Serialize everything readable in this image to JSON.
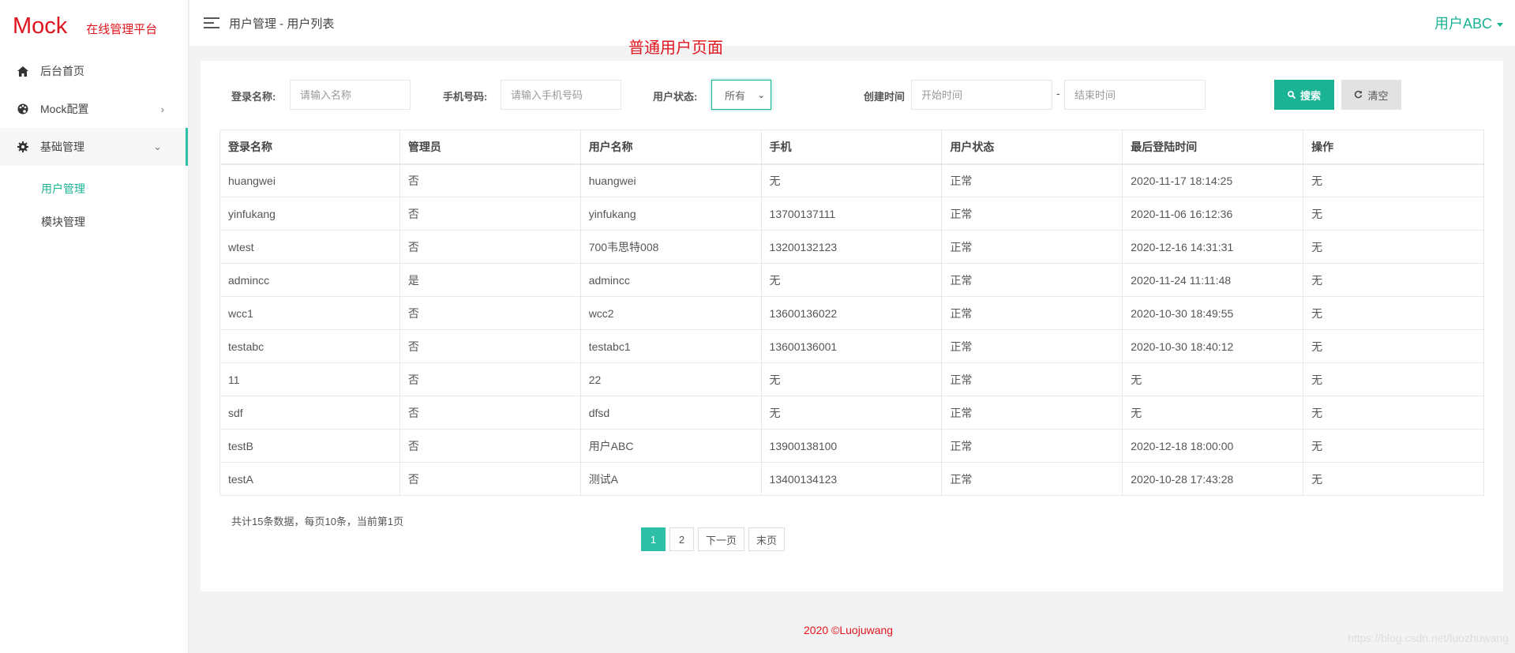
{
  "brand": {
    "name": "Mock",
    "subtitle": "在线管理平台"
  },
  "sidebar": {
    "items": [
      {
        "label": "后台首页",
        "icon": "home-icon"
      },
      {
        "label": "Mock配置",
        "icon": "palette-icon"
      },
      {
        "label": "基础管理",
        "icon": "gear-icon"
      }
    ],
    "sub_items": [
      {
        "label": "用户管理"
      },
      {
        "label": "模块管理"
      }
    ]
  },
  "header": {
    "breadcrumb": "用户管理 - 用户列表",
    "user": "用户ABC"
  },
  "annotation": "普通用户页面",
  "filters": {
    "login_label": "登录名称:",
    "login_placeholder": "请输入名称",
    "phone_label": "手机号码:",
    "phone_placeholder": "请输入手机号码",
    "status_label": "用户状态:",
    "status_value": "所有",
    "created_label": "创建时间",
    "start_placeholder": "开始时间",
    "separator": "-",
    "end_placeholder": "结束时间",
    "search_label": "搜索",
    "clear_label": "清空"
  },
  "table": {
    "columns": [
      "登录名称",
      "管理员",
      "用户名称",
      "手机",
      "用户状态",
      "最后登陆时间",
      "操作"
    ],
    "rows": [
      [
        "huangwei",
        "否",
        "huangwei",
        "无",
        "正常",
        "2020-11-17 18:14:25",
        "无"
      ],
      [
        "yinfukang",
        "否",
        "yinfukang",
        "13700137111",
        "正常",
        "2020-11-06 16:12:36",
        "无"
      ],
      [
        "wtest",
        "否",
        "700韦思特008",
        "13200132123",
        "正常",
        "2020-12-16 14:31:31",
        "无"
      ],
      [
        "admincc",
        "是",
        "admincc",
        "无",
        "正常",
        "2020-11-24 11:11:48",
        "无"
      ],
      [
        "wcc1",
        "否",
        "wcc2",
        "13600136022",
        "正常",
        "2020-10-30 18:49:55",
        "无"
      ],
      [
        "testabc",
        "否",
        "testabc1",
        "13600136001",
        "正常",
        "2020-10-30 18:40:12",
        "无"
      ],
      [
        "11",
        "否",
        "22",
        "无",
        "正常",
        "无",
        "无"
      ],
      [
        "sdf",
        "否",
        "dfsd",
        "无",
        "正常",
        "无",
        "无"
      ],
      [
        "testB",
        "否",
        "用户ABC",
        "13900138100",
        "正常",
        "2020-12-18 18:00:00",
        "无"
      ],
      [
        "testA",
        "否",
        "测试A",
        "13400134123",
        "正常",
        "2020-10-28 17:43:28",
        "无"
      ]
    ]
  },
  "pagination": {
    "summary": "共计15条数据，每页10条，当前第1页",
    "pages": [
      "1",
      "2"
    ],
    "next": "下一页",
    "last": "末页"
  },
  "footer": "2020 ©Luojuwang",
  "watermark": "https://blog.csdn.net/luozhuwang",
  "colors": {
    "accent": "#1ab394",
    "brand": "#e0141e"
  }
}
